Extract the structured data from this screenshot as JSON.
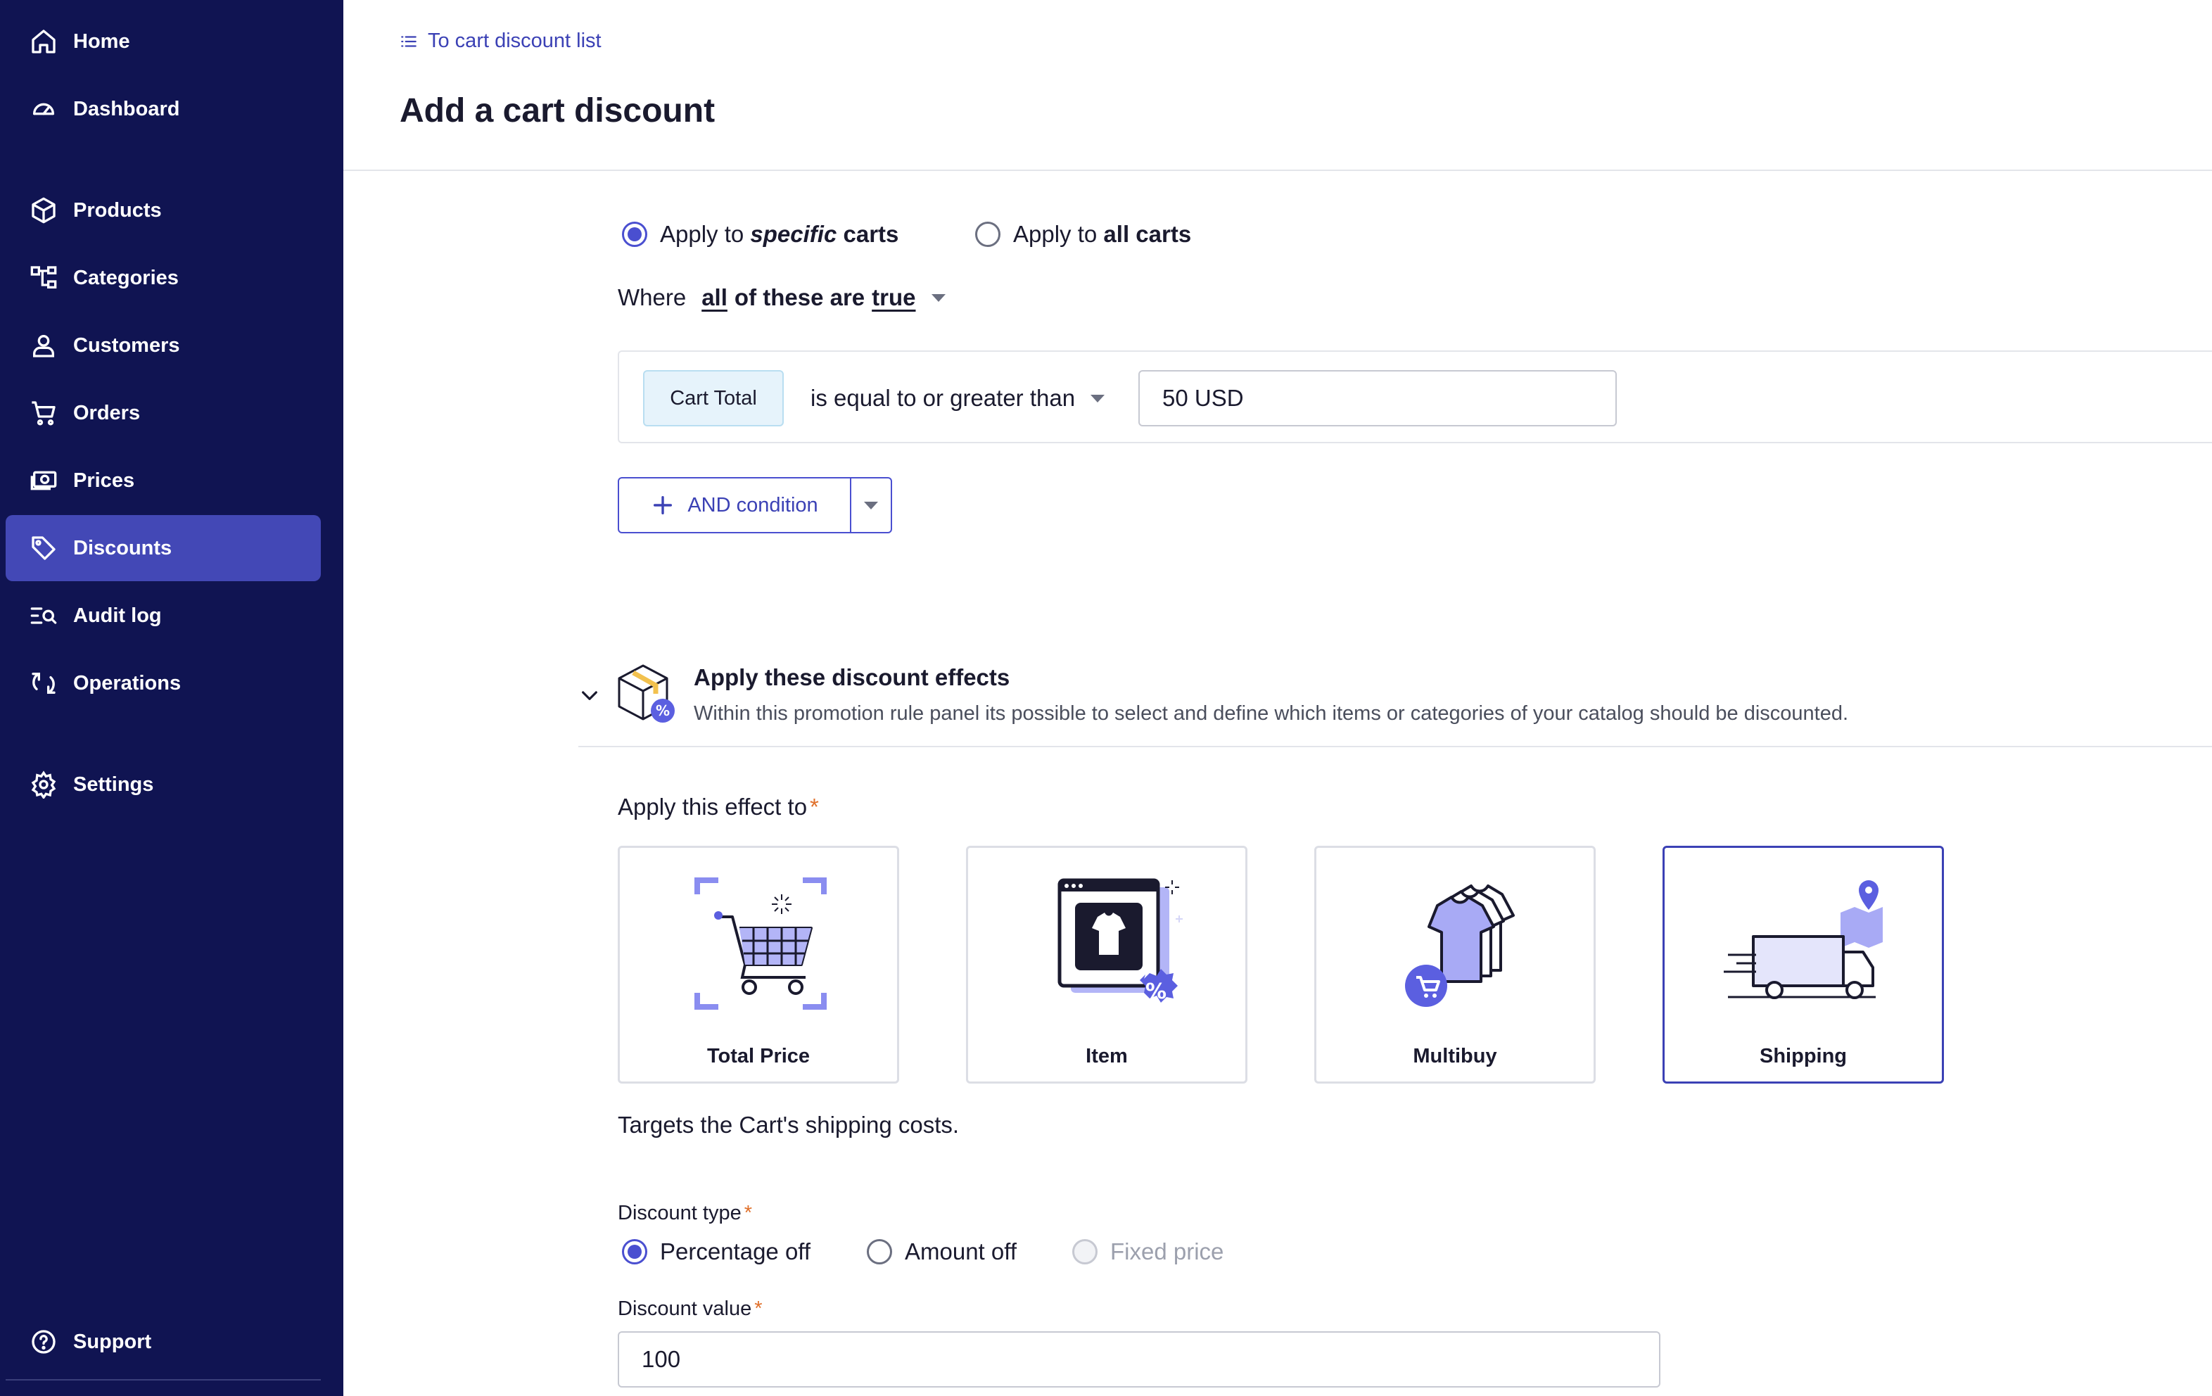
{
  "sidebar": {
    "items": [
      {
        "label": "Home",
        "icon": "home-icon"
      },
      {
        "label": "Dashboard",
        "icon": "dashboard-icon"
      },
      {
        "label": "Products",
        "icon": "cube-icon"
      },
      {
        "label": "Categories",
        "icon": "hierarchy-icon"
      },
      {
        "label": "Customers",
        "icon": "person-icon"
      },
      {
        "label": "Orders",
        "icon": "cart-icon"
      },
      {
        "label": "Prices",
        "icon": "money-icon"
      },
      {
        "label": "Discounts",
        "icon": "tag-icon",
        "active": true
      },
      {
        "label": "Audit log",
        "icon": "list-search-icon"
      },
      {
        "label": "Operations",
        "icon": "refresh-icon"
      },
      {
        "label": "Settings",
        "icon": "gear-icon"
      }
    ],
    "support": {
      "label": "Support",
      "icon": "question-icon"
    }
  },
  "header": {
    "breadcrumb": "To cart discount list",
    "title": "Add a cart discount"
  },
  "target": {
    "option_specific": {
      "prefix": "Apply to",
      "emphasis": "specific",
      "suffix": "carts",
      "checked": true
    },
    "option_all": {
      "prefix": "Apply to",
      "emphasis": "all carts",
      "checked": false
    }
  },
  "where": {
    "label": "Where",
    "quantifier": "all",
    "middle": "of these are",
    "truth": "true"
  },
  "condition": {
    "field": "Cart Total",
    "operator": "is equal to or greater than",
    "value": "50 USD"
  },
  "and_condition_label": "AND condition",
  "effects": {
    "title": "Apply these discount effects",
    "description": "Within this promotion rule panel its possible to select and define which items or categories of your catalog should be discounted."
  },
  "apply_effect_label": "Apply this effect to",
  "required_mark": "*",
  "effect_cards": [
    {
      "label": "Total Price",
      "icon": "cart-illustration-icon",
      "selected": false
    },
    {
      "label": "Item",
      "icon": "shirt-window-illustration-icon",
      "selected": false
    },
    {
      "label": "Multibuy",
      "icon": "shirts-stack-illustration-icon",
      "selected": false
    },
    {
      "label": "Shipping",
      "icon": "delivery-truck-illustration-icon",
      "selected": true
    }
  ],
  "selected_effect_description": "Targets the Cart's shipping costs.",
  "discount_type": {
    "label": "Discount type",
    "options": [
      {
        "label": "Percentage off",
        "checked": true,
        "disabled": false
      },
      {
        "label": "Amount off",
        "checked": false,
        "disabled": false
      },
      {
        "label": "Fixed price",
        "checked": false,
        "disabled": true
      }
    ]
  },
  "discount_value": {
    "label": "Discount value",
    "value": "100"
  },
  "colors": {
    "sidebar_bg": "#101452",
    "active_item": "#4348b6",
    "accent": "#4a4fd0",
    "required": "#e0702b"
  }
}
